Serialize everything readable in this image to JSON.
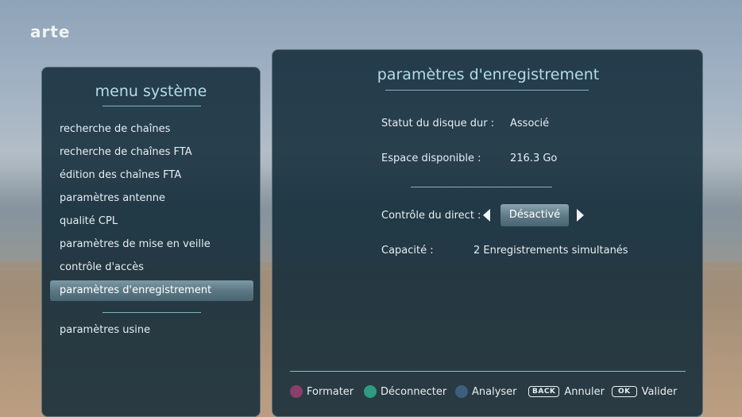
{
  "brand": "arte",
  "system_menu": {
    "title": "menu système",
    "items": [
      {
        "label": "recherche de chaînes"
      },
      {
        "label": "recherche de chaînes FTA"
      },
      {
        "label": "édition des chaînes FTA"
      },
      {
        "label": "paramètres antenne"
      },
      {
        "label": "qualité CPL"
      },
      {
        "label": "paramètres de mise en veille"
      },
      {
        "label": "contrôle d'accès"
      },
      {
        "label": "paramètres d'enregistrement",
        "selected": true
      }
    ],
    "extra_item": "paramètres usine"
  },
  "recording_settings": {
    "title": "paramètres d'enregistrement",
    "disk_status_label": "Statut du disque dur :",
    "disk_status_value": "Associé",
    "free_space_label": "Espace disponible :",
    "free_space_value": "216.3 Go",
    "live_control_label": "Contrôle du direct :",
    "live_control_value": "Désactivé",
    "capacity_label": "Capacité :",
    "capacity_value": "2 Enregistrements simultanés"
  },
  "footer": {
    "format": {
      "label": "Formater",
      "color": "#8a3f6a"
    },
    "disconnect": {
      "label": "Déconnecter",
      "color": "#2f9a82"
    },
    "analyze": {
      "label": "Analyser",
      "color": "#3d5f7e"
    },
    "back_key": "BACK",
    "cancel": "Annuler",
    "ok_key": "OK",
    "validate": "Valider"
  }
}
